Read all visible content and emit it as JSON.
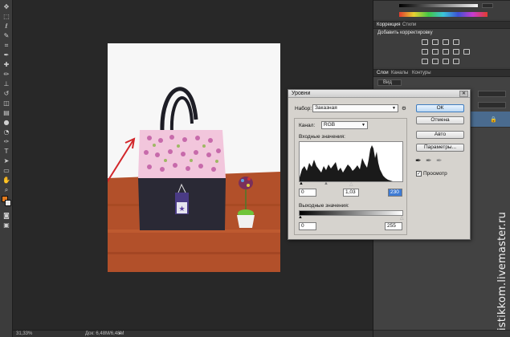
{
  "toolbar": {
    "tools": [
      "move-icon",
      "marquee-icon",
      "lasso-icon",
      "quick-select-icon",
      "crop-icon",
      "eyedropper-icon",
      "healing-icon",
      "brush-icon",
      "stamp-icon",
      "history-brush-icon",
      "eraser-icon",
      "gradient-icon",
      "blur-icon",
      "dodge-icon",
      "pen-icon",
      "type-icon",
      "path-select-icon",
      "shape-icon",
      "hand-icon",
      "zoom-icon"
    ],
    "foreground_color": "#e07a1e",
    "background_color": "#e8e8e8"
  },
  "status": {
    "zoom": "31,33%",
    "doc": "Док: 6,48M/6,48M"
  },
  "corrections_panel": {
    "tabs": [
      "Коррекция",
      "Стили"
    ],
    "title": "Добавить корректировку"
  },
  "layers_panel": {
    "tabs": [
      "Слои",
      "Каналы",
      "Контуры"
    ],
    "filter": "Вид"
  },
  "levels_dialog": {
    "title": "Уровни",
    "preset_label": "Набор:",
    "preset_value": "Заказная",
    "channel_label": "Канал:",
    "channel_value": "RGB",
    "input_label": "Входные значения:",
    "input_black": "0",
    "input_gamma": "1,03",
    "input_white": "230",
    "output_label": "Выходные значения:",
    "output_black": "0",
    "output_white": "255",
    "buttons": {
      "ok": "ОК",
      "cancel": "Отмена",
      "auto": "Авто",
      "options": "Параметры..."
    },
    "preview_label": "Просмотр",
    "preview_checked": true
  },
  "watermark": "istikkom.livemaster.ru"
}
